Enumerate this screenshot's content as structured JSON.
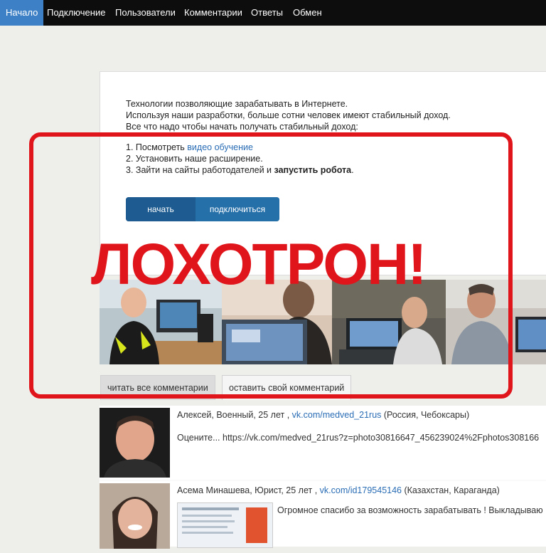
{
  "nav": {
    "items": [
      {
        "label": "Начало",
        "active": true
      },
      {
        "label": "Подключение"
      },
      {
        "label": "Пользователи"
      },
      {
        "label": "Комментарии"
      },
      {
        "label": "Ответы"
      },
      {
        "label": "Обмен"
      }
    ]
  },
  "intro": {
    "line1": "Технологии позволяющие зарабатывать в Интернете.",
    "line2": "Используя наши разработки, больше сотни человек имеют стабильный доход.",
    "line3": "Все что надо чтобы начать получать стабильный доход:"
  },
  "steps": {
    "s1_prefix": "1. Посмотреть ",
    "s1_link": "видео обучение",
    "s2": "2. Установить наше расширение.",
    "s3_prefix": "3. Зайти на сайты работодателей и ",
    "s3_bold": "запустить робота",
    "s3_suffix": "."
  },
  "buttons": {
    "start": "начать",
    "connect": "подключиться"
  },
  "tabs": {
    "read": "читать все комментарии",
    "write": "оставить свой комментарий"
  },
  "comments": [
    {
      "name": "Алексей, Военный, 25 лет , ",
      "link": "vk.com/medved_21rus",
      "location": " (Россия, Чебоксары)",
      "text": "Оцените... https://vk.com/medved_21rus?z=photo30816647_456239024%2Fphotos308166"
    },
    {
      "name": "Асема Минашева, Юрист, 25 лет , ",
      "link": "vk.com/id179545146",
      "location": " (Казахстан, Караганда)",
      "text": "Огромное спасибо за возможность зарабатывать ! Выкладываю"
    }
  ],
  "stamp": {
    "text": "ЛОХОТРОН!",
    "color": "#e0141b"
  },
  "colors": {
    "nav_bg": "#0d0d0d",
    "nav_active": "#3d80c5",
    "button_primary": "#1d5b90",
    "link": "#2a6db5"
  }
}
